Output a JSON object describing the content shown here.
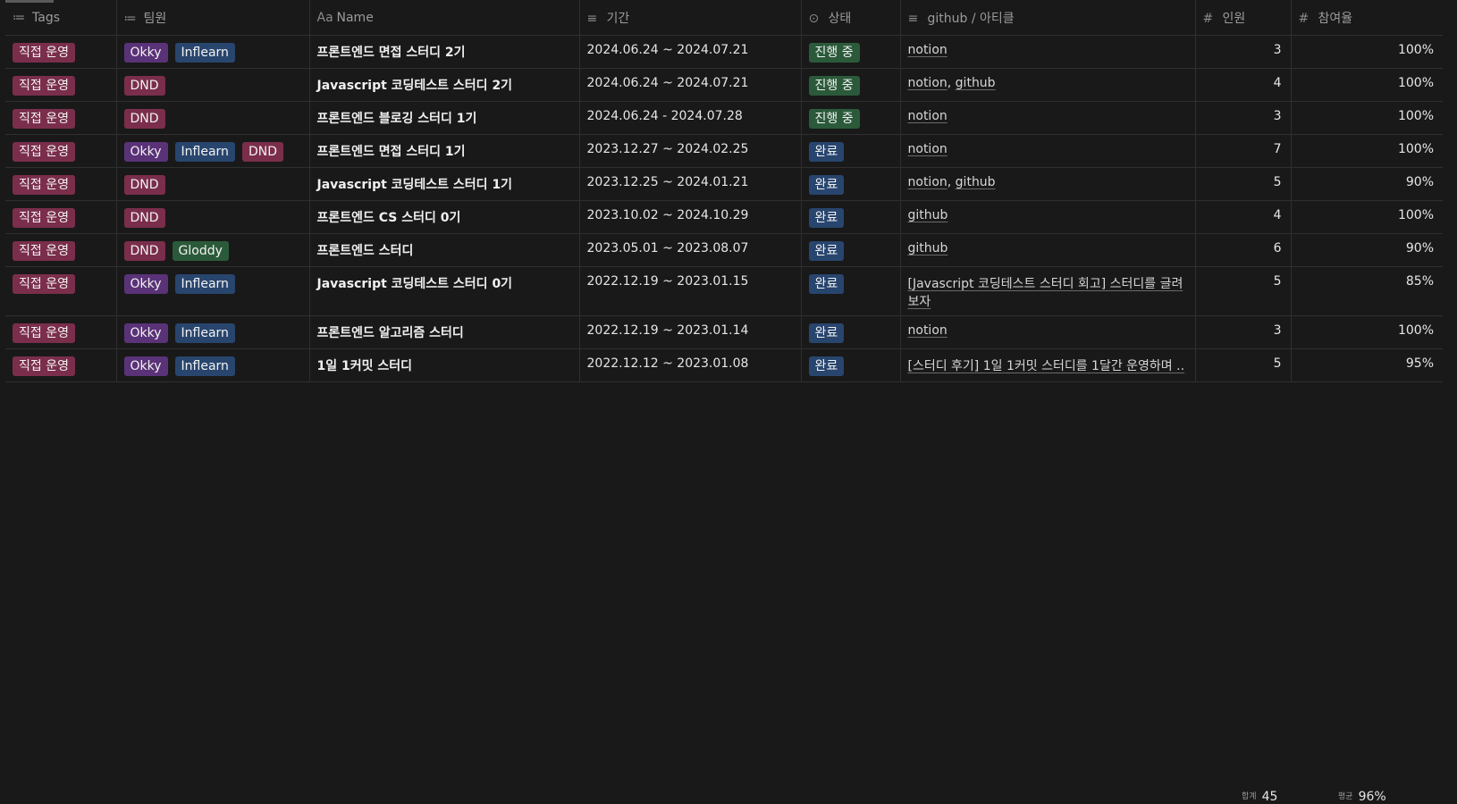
{
  "headers": [
    {
      "label": "Tags",
      "icon": "≔"
    },
    {
      "label": "팀원",
      "icon": "≔"
    },
    {
      "label": "Name",
      "icon": "Aa"
    },
    {
      "label": "기간",
      "icon": "≡"
    },
    {
      "label": "상태",
      "icon": "⊙"
    },
    {
      "label": "github / 아티클",
      "icon": "≡"
    },
    {
      "label": "인원",
      "icon": "#"
    },
    {
      "label": "참여율",
      "icon": "#"
    }
  ],
  "tag_colors": {
    "직접 운영": "#7a2e4b",
    "Okky": "#5a3278",
    "Inflearn": "#28456e",
    "DND": "#7a2e4b",
    "Gloddy": "#2b5a3a"
  },
  "status_colors": {
    "진행 중": "#2b5a3a",
    "완료": "#28456e"
  },
  "rows": [
    {
      "tags": [
        "직접 운영"
      ],
      "team": [
        "Okky",
        "Inflearn"
      ],
      "name": "프론트엔드 면접 스터디 2기",
      "period": "2024.06.24 ~ 2024.07.21",
      "status": "진행 중",
      "links": [
        "notion"
      ],
      "count": "3",
      "rate": "100%"
    },
    {
      "tags": [
        "직접 운영"
      ],
      "team": [
        "DND"
      ],
      "name": "Javascript 코딩테스트 스터디 2기",
      "period": "2024.06.24 ~ 2024.07.21",
      "status": "진행 중",
      "links": [
        "notion",
        "github"
      ],
      "count": "4",
      "rate": "100%"
    },
    {
      "tags": [
        "직접 운영"
      ],
      "team": [
        "DND"
      ],
      "name": "프론트엔드 블로깅 스터디 1기",
      "period": "2024.06.24 - 2024.07.28",
      "status": "진행 중",
      "links": [
        "notion"
      ],
      "count": "3",
      "rate": "100%"
    },
    {
      "tags": [
        "직접 운영"
      ],
      "team": [
        "Okky",
        "Inflearn",
        "DND"
      ],
      "name": "프론트엔드 면접 스터디 1기",
      "period": "2023.12.27 ~ 2024.02.25",
      "status": "완료",
      "links": [
        "notion"
      ],
      "count": "7",
      "rate": "100%"
    },
    {
      "tags": [
        "직접 운영"
      ],
      "team": [
        "DND"
      ],
      "name": "Javascript 코딩테스트 스터디 1기",
      "period": "2023.12.25 ~ 2024.01.21",
      "status": "완료",
      "links": [
        "notion",
        "github"
      ],
      "count": "5",
      "rate": "90%"
    },
    {
      "tags": [
        "직접 운영"
      ],
      "team": [
        "DND"
      ],
      "name": "프론트엔드 CS 스터디 0기",
      "period": "2023.10.02 ~ 2024.10.29",
      "status": "완료",
      "links": [
        "github"
      ],
      "count": "4",
      "rate": "100%"
    },
    {
      "tags": [
        "직접 운영"
      ],
      "team": [
        "DND",
        "Gloddy"
      ],
      "name": "프론트엔드 스터디",
      "period": "2023.05.01 ~ 2023.08.07",
      "status": "완료",
      "links": [
        "github"
      ],
      "count": "6",
      "rate": "90%"
    },
    {
      "tags": [
        "직접 운영"
      ],
      "team": [
        "Okky",
        "Inflearn"
      ],
      "name": "Javascript 코딩테스트 스터디 0기",
      "period": "2022.12.19 ~ 2023.01.15",
      "status": "완료",
      "links": [
        "[Javascript 코딩테스트 스터디 회고] 스터디를 글려보자"
      ],
      "count": "5",
      "rate": "85%"
    },
    {
      "tags": [
        "직접 운영"
      ],
      "team": [
        "Okky",
        "Inflearn"
      ],
      "name": "프론트엔드 알고리즘 스터디",
      "period": "2022.12.19 ~ 2023.01.14",
      "status": "완료",
      "links": [
        "notion"
      ],
      "count": "3",
      "rate": "100%"
    },
    {
      "tags": [
        "직접 운영"
      ],
      "team": [
        "Okky",
        "Inflearn"
      ],
      "name": "1일 1커밋 스터디",
      "period": "2022.12.12 ~ 2023.01.08",
      "status": "완료",
      "links": [
        "[스터디 후기] 1일 1커밋 스터디를 1달간 운영하며 .."
      ],
      "count": "5",
      "rate": "95%"
    }
  ],
  "summary": {
    "sum_label": "합계",
    "sum_value": "45",
    "avg_label": "평균",
    "avg_value": "96%"
  }
}
